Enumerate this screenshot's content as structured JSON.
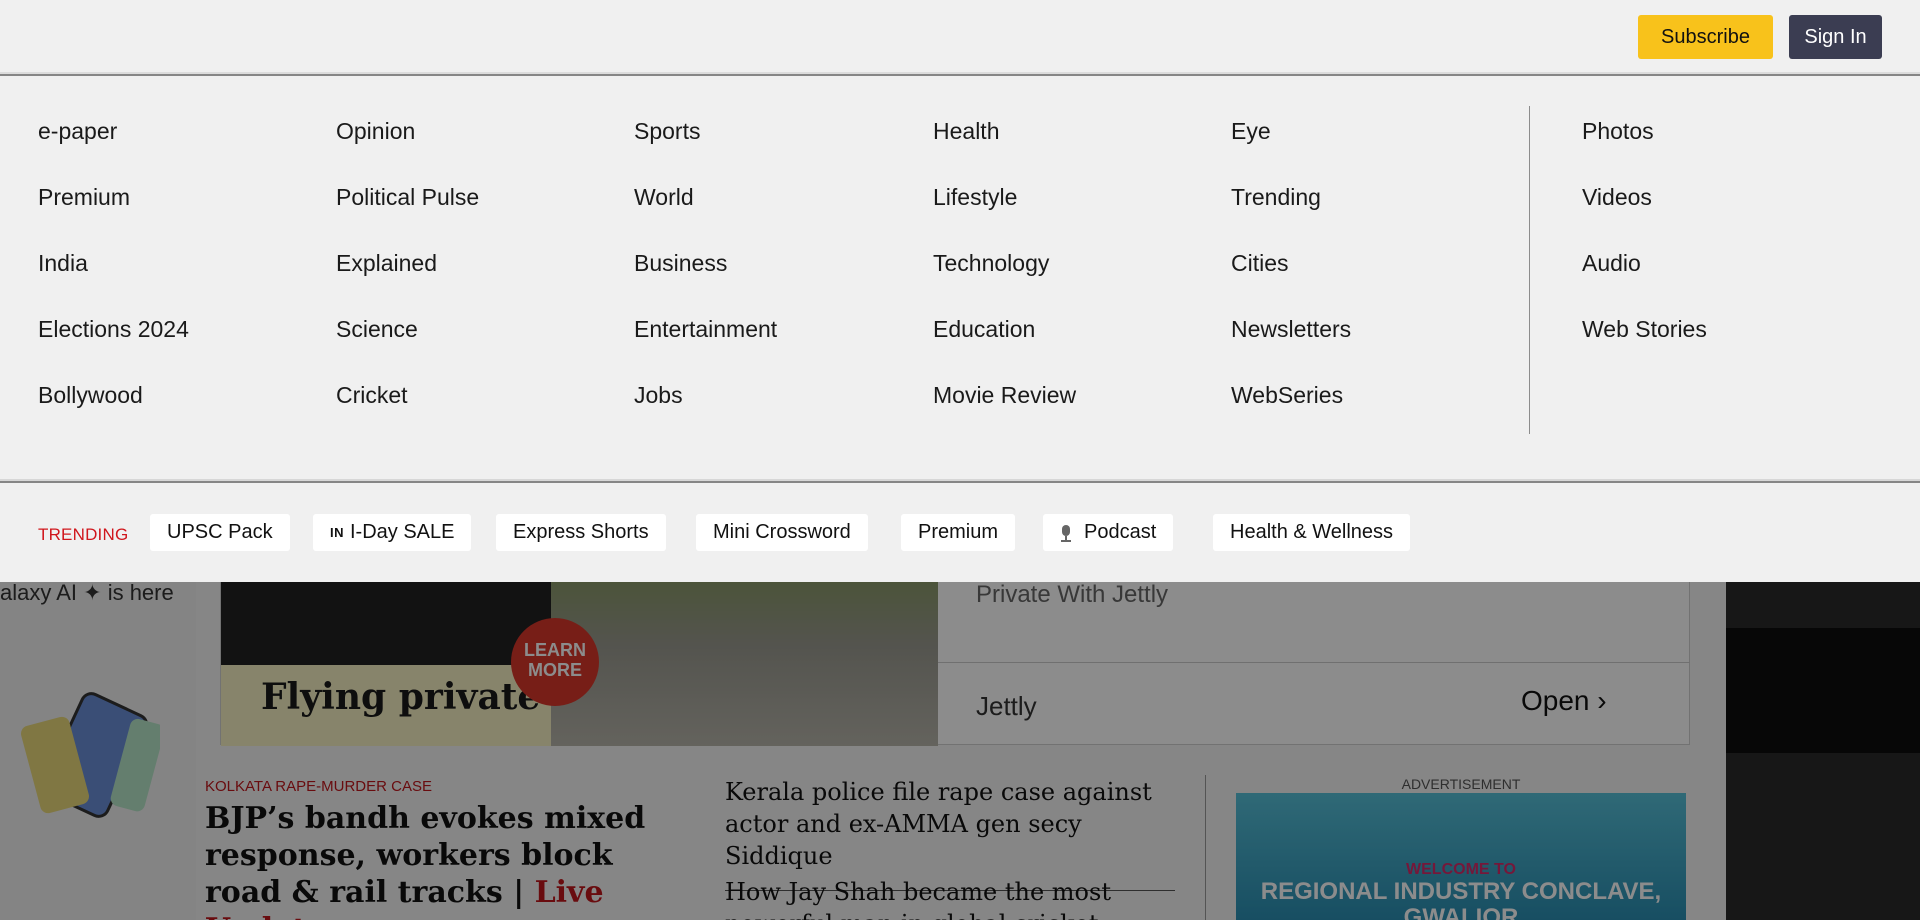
{
  "header": {
    "subscribe_label": "Subscribe",
    "signin_label": "Sign In",
    "colors": {
      "subscribe_bg": "#f8c21b",
      "signin_bg": "#3b3d52"
    }
  },
  "menu": {
    "columns": [
      [
        "e-paper",
        "Premium",
        "India",
        "Elections 2024",
        "Bollywood"
      ],
      [
        "Opinion",
        "Political Pulse",
        "Explained",
        "Science",
        "Cricket"
      ],
      [
        "Sports",
        "World",
        "Business",
        "Entertainment",
        "Jobs"
      ],
      [
        "Health",
        "Lifestyle",
        "Technology",
        "Education",
        "Movie Review"
      ],
      [
        "Eye",
        "Trending",
        "Cities",
        "Newsletters",
        "WebSeries"
      ],
      [
        "Photos",
        "Videos",
        "Audio",
        "Web Stories"
      ]
    ]
  },
  "trending": {
    "label": "TRENDING",
    "label_color": "#d0161c",
    "items": [
      {
        "label": "UPSC Pack"
      },
      {
        "label": "I-Day SALE",
        "prefix": "IN"
      },
      {
        "label": "Express Shorts"
      },
      {
        "label": "Mini Crossword"
      },
      {
        "label": "Premium"
      },
      {
        "label": "Podcast",
        "icon": "microphone-icon"
      },
      {
        "label": "Health & Wellness"
      }
    ]
  },
  "background": {
    "left_ad_text": "alaxy AI ✦ is here",
    "ad": {
      "image_title": "Flying private",
      "learn_more": "LEARN MORE",
      "subtitle": "Private With Jettly",
      "brand": "Jettly",
      "open_label": "Open ›"
    },
    "lead_story": {
      "kicker": "KOLKATA RAPE-MURDER CASE",
      "headline": "BJP’s bandh evokes mixed response, workers block road & rail tracks",
      "separator": "|",
      "live_label": "Live Updates"
    },
    "stories": [
      "Kerala police file rape case against actor and ex-AMMA gen secy Siddique",
      "How Jay Shah became the most powerful man in global cricket"
    ],
    "advertisement_label": "ADVERTISEMENT",
    "side_ad": {
      "welcome": "WELCOME TO",
      "title": "REGIONAL INDUSTRY CONCLAVE, GWALIOR"
    }
  }
}
